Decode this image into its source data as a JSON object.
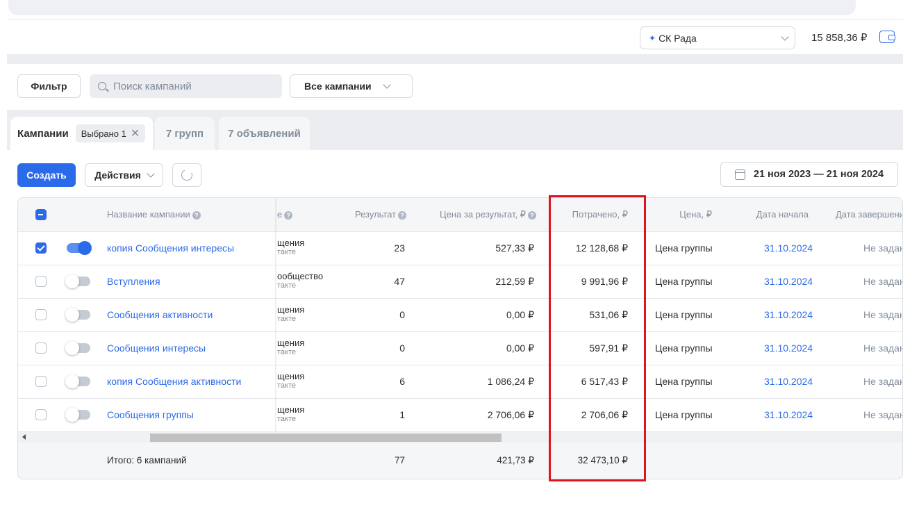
{
  "header": {
    "account": "СК Рада",
    "balance": "15 858,36 ₽"
  },
  "toolbar": {
    "filter_label": "Фильтр",
    "search_placeholder": "Поиск кампаний",
    "all_campaigns_label": "Все кампании"
  },
  "tabs": {
    "campaigns": "Кампании",
    "selected_chip": "Выбрано 1",
    "groups": "7 групп",
    "ads": "7 объявлений"
  },
  "actions": {
    "create_label": "Создать",
    "actions_label": "Действия",
    "date_range": "21 ноя 2023 — 21 ноя 2024"
  },
  "table": {
    "columns": {
      "name": "Название кампании",
      "goal_fragment": "е",
      "result": "Результат",
      "cost_per_result": "Цена за результат, ₽",
      "spent": "Потрачено, ₽",
      "price": "Цена, ₽",
      "start_date": "Дата начала",
      "end_date": "Дата завершени"
    },
    "rows": [
      {
        "name": "копия Сообщения интересы",
        "goal": "щения",
        "goal_sub": "такте",
        "result": "23",
        "cpr": "527,33 ₽",
        "spent": "12 128,68 ₽",
        "price": "Цена группы",
        "start": "31.10.2024",
        "end": "Не задан",
        "checked": true,
        "active": true
      },
      {
        "name": "Вступления",
        "goal": "ообщество",
        "goal_sub": "такте",
        "result": "47",
        "cpr": "212,59 ₽",
        "spent": "9 991,96 ₽",
        "price": "Цена группы",
        "start": "31.10.2024",
        "end": "Не задан",
        "checked": false,
        "active": false
      },
      {
        "name": "Сообщения активности",
        "goal": "щения",
        "goal_sub": "такте",
        "result": "0",
        "cpr": "0,00 ₽",
        "spent": "531,06 ₽",
        "price": "Цена группы",
        "start": "31.10.2024",
        "end": "Не задан",
        "checked": false,
        "active": false
      },
      {
        "name": "Сообщения интересы",
        "goal": "щения",
        "goal_sub": "такте",
        "result": "0",
        "cpr": "0,00 ₽",
        "spent": "597,91 ₽",
        "price": "Цена группы",
        "start": "31.10.2024",
        "end": "Не задан",
        "checked": false,
        "active": false
      },
      {
        "name": "копия Сообщения активности",
        "goal": "щения",
        "goal_sub": "такте",
        "result": "6",
        "cpr": "1 086,24 ₽",
        "spent": "6 517,43 ₽",
        "price": "Цена группы",
        "start": "31.10.2024",
        "end": "Не задан",
        "checked": false,
        "active": false
      },
      {
        "name": "Сообщения группы",
        "goal": "щения",
        "goal_sub": "такте",
        "result": "1",
        "cpr": "2 706,06 ₽",
        "spent": "2 706,06 ₽",
        "price": "Цена группы",
        "start": "31.10.2024",
        "end": "Не задан",
        "checked": false,
        "active": false
      }
    ],
    "total": {
      "label": "Итого: 6 кампаний",
      "result": "77",
      "cpr": "421,73 ₽",
      "spent": "32 473,10 ₽"
    }
  },
  "colors": {
    "accent": "#2b6ae8",
    "highlight": "#e0141e"
  }
}
